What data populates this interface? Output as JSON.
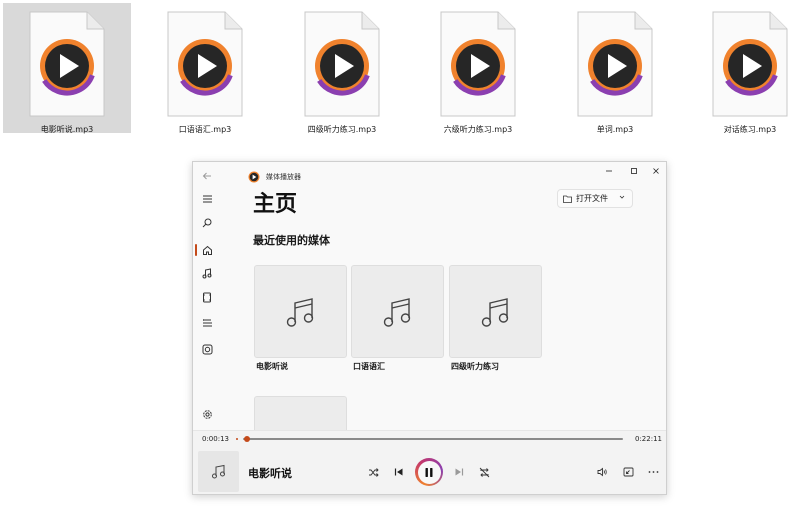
{
  "desktop_files": [
    {
      "name": "电影听说.mp3",
      "selected": true,
      "icon": "media-file-icon"
    },
    {
      "name": "口语语汇.mp3",
      "selected": false,
      "icon": "media-file-icon"
    },
    {
      "name": "四级听力练习.mp3",
      "selected": false,
      "icon": "media-file-icon"
    },
    {
      "name": "六级听力练习.mp3",
      "selected": false,
      "icon": "media-file-icon"
    },
    {
      "name": "单词.mp3",
      "selected": false,
      "icon": "media-file-icon"
    },
    {
      "name": "对话练习.mp3",
      "selected": false,
      "icon": "media-file-icon"
    }
  ],
  "player": {
    "app_title": "媒体播放器",
    "page_title": "主页",
    "open_file_label": "打开文件",
    "section_title": "最近使用的媒体",
    "recent": [
      {
        "label": "电影听说"
      },
      {
        "label": "口语语汇"
      },
      {
        "label": "四级听力练习"
      }
    ],
    "nav": [
      "back-icon",
      "menu-icon",
      "search-icon",
      "home-icon",
      "music-icon",
      "video-icon",
      "playlist-icon",
      "disc-icon",
      "settings-icon"
    ],
    "elapsed": "0:00:13",
    "duration": "0:22:11",
    "progress": 0.01,
    "now_playing": "电影听说"
  },
  "colors": {
    "accent": "#c44a1a",
    "brand_ring_orange": "#f0822d",
    "brand_ring_purple": "#8b3fb0"
  }
}
